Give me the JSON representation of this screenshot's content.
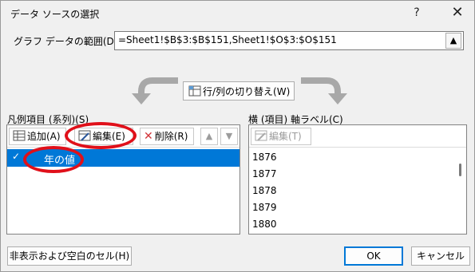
{
  "dialog": {
    "title": "データ ソースの選択",
    "help": "?",
    "close": "✕"
  },
  "range": {
    "label": "グラフ データの範囲(D):",
    "value": "=Sheet1!$B$3:$B$151,Sheet1!$O$3:$O$151",
    "collapse_icon": "▲"
  },
  "switch_button": {
    "label": "行/列の切り替え(W)"
  },
  "legend": {
    "label": "凡例項目 (系列)(S)",
    "add": "追加(A)",
    "edit": "編集(E)",
    "delete": "削除(R)",
    "up": "▲",
    "down": "▼",
    "series": [
      {
        "check": "✓",
        "name": "年の値"
      }
    ]
  },
  "axis": {
    "label": "横 (項目) 軸ラベル(C)",
    "edit": "編集(T)",
    "items": [
      "1876",
      "1877",
      "1878",
      "1879",
      "1880"
    ]
  },
  "footer": {
    "hidden_cells": "非表示および空白のセル(H)",
    "ok": "OK",
    "cancel": "キャンセル"
  },
  "colors": {
    "accent": "#0078d7",
    "highlight_ring": "#e0101a"
  }
}
